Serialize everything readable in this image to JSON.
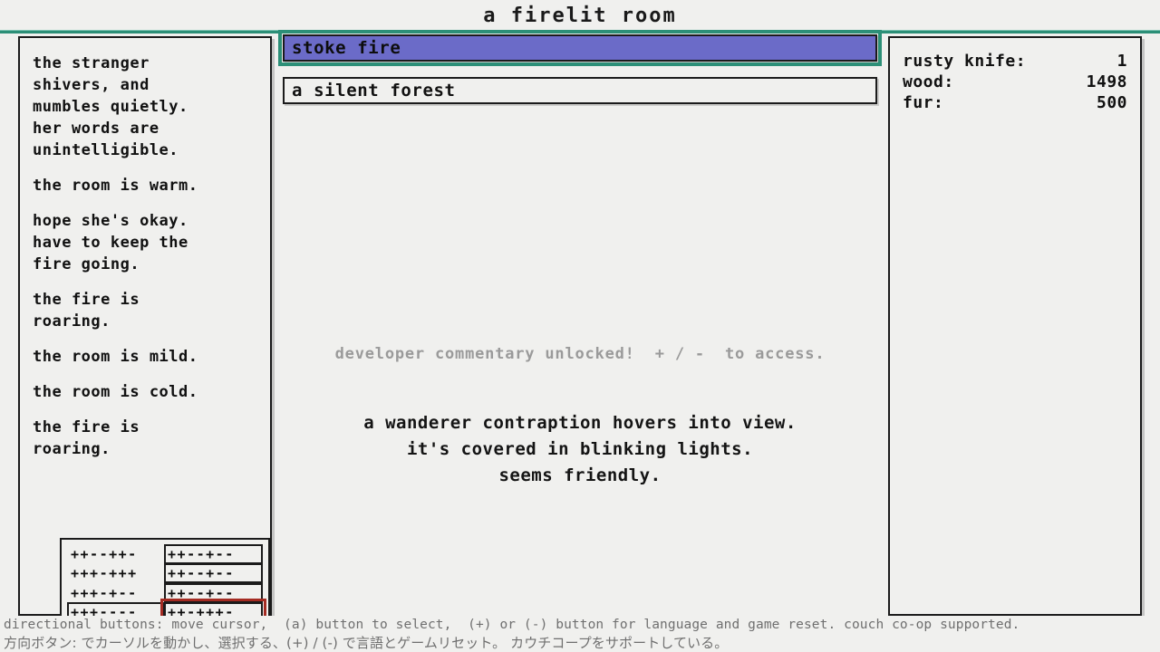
{
  "header": {
    "title": "a firelit room",
    "rule_color": "#2C8F77"
  },
  "left_panel": {
    "name": "event-log",
    "entries": [
      "the stranger\nshivers, and\nmumbles quietly.\nher words are\nunintelligible.",
      "the room is warm.",
      "hope she's okay.\nhave to keep the\nfire going.",
      "the fire is\nroaring.",
      "the room is mild.",
      "the room is cold.",
      "the fire is\nroaring."
    ]
  },
  "cipher_widget": {
    "name": "pattern-grid",
    "highlight_color": "#A42B22",
    "rows": [
      {
        "left": "++--++-",
        "left_boxed": false,
        "right": "++--+--",
        "right_boxed": true,
        "active": false
      },
      {
        "left": "+++-+++",
        "left_boxed": false,
        "right": "++--+--",
        "right_boxed": true,
        "active": false
      },
      {
        "left": "+++-+--",
        "left_boxed": false,
        "right": "++--+--",
        "right_boxed": true,
        "active": false
      },
      {
        "left": "+++----",
        "left_boxed": true,
        "right": "++-+++-",
        "right_boxed": true,
        "active": true
      }
    ]
  },
  "center": {
    "buttons": [
      {
        "label": "stoke fire",
        "selected": true
      },
      {
        "label": "a silent forest",
        "selected": false
      }
    ],
    "notice": "developer commentary unlocked!  + / -  to access.",
    "event_lines": [
      "a wanderer contraption hovers into view.",
      "it's covered in blinking lights.",
      "seems friendly."
    ],
    "selected_color": "#6B6BC8",
    "selected_outline": "#2C8F77"
  },
  "right_panel": {
    "name": "stores",
    "items": [
      {
        "label": "rusty knife:",
        "qty": "1"
      },
      {
        "label": "wood:",
        "qty": "1498"
      },
      {
        "label": "fur:",
        "qty": "500"
      }
    ]
  },
  "help_bar": {
    "line_en": "directional buttons: move cursor,  (a) button to select,  (+) or (-) button for language and game reset. couch co-op supported.",
    "line_jp": "方向ボタン: でカーソルを動かし、選択する、(+) / (-) で言語とゲームリセット。 カウチコープをサポートしている。"
  }
}
